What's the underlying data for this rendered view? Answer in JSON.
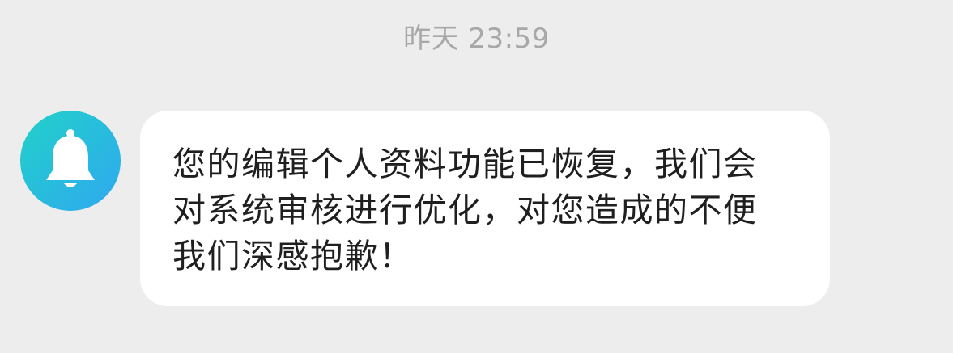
{
  "chat": {
    "timestamp": "昨天 23:59",
    "message": {
      "sender_icon": "bell-icon",
      "text": "您的编辑个人资料功能已恢复，我们会对系统审核进行优化，对您造成的不便我们深感抱歉！"
    }
  },
  "colors": {
    "background": "#ededed",
    "bubble": "#ffffff",
    "avatar_gradient_start": "#21d1c9",
    "avatar_gradient_end": "#2fa8f0",
    "timestamp_text": "#a8a8a8",
    "message_text": "#1f1f1f"
  }
}
